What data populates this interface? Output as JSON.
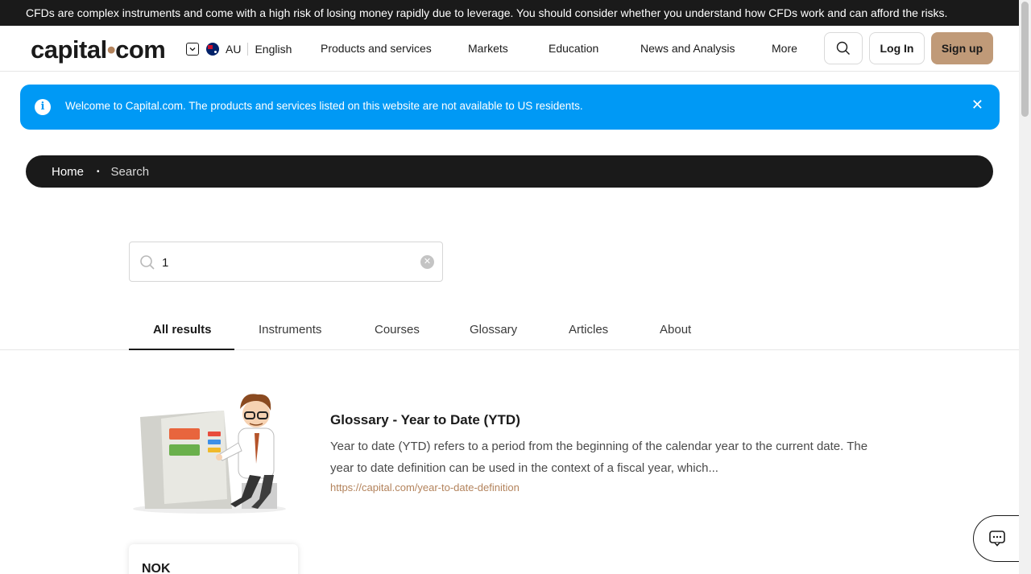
{
  "risk_warning": "CFDs are complex instruments and come with a high risk of losing money rapidly due to leverage. You should consider whether you understand how CFDs work and can afford the risks.",
  "header": {
    "logo_left": "capital",
    "logo_dot": "•",
    "logo_right": "com",
    "region": "AU",
    "language": "English",
    "nav": [
      "Products and services",
      "Markets",
      "Education",
      "News and Analysis",
      "More"
    ],
    "login_label": "Log In",
    "signup_label": "Sign up"
  },
  "notice": {
    "message": "Welcome to Capital.com. The products and services listed on this website are not available to US residents.",
    "close_icon": "close-icon"
  },
  "breadcrumb": {
    "home": "Home",
    "separator": "•",
    "current": "Search"
  },
  "search": {
    "value": "1"
  },
  "tabs": [
    "All results",
    "Instruments",
    "Courses",
    "Glossary",
    "Articles",
    "About"
  ],
  "active_tab": "All results",
  "results": [
    {
      "title": "Glossary - Year to Date (YTD)",
      "description": "Year to date (YTD) refers to a period from the beginning of the calendar year to the current date.  The year to date definition can be used in the context of a fiscal year, which...",
      "url": "https://capital.com/year-to-date-definition"
    }
  ],
  "instrument_card": {
    "name": "NOK"
  },
  "colors": {
    "brand_accent": "#c09a78",
    "notice_blue": "#0099f5",
    "dark": "#1a1a1a",
    "link": "#b3835c"
  }
}
